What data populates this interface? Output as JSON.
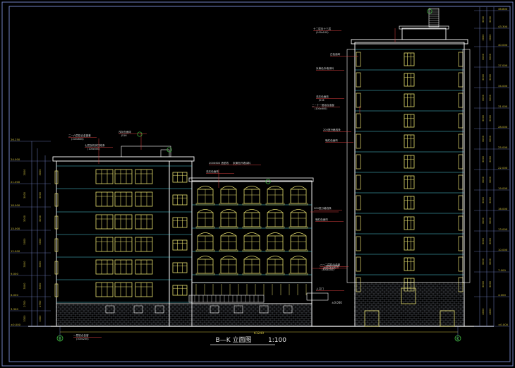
{
  "drawing": {
    "title": "B—K 立面图",
    "scale": "1:100",
    "grid_start": "B",
    "grid_end": "K",
    "total_dim": "61240",
    "note_ground": "±0.000"
  },
  "left_levels": [
    "26.250",
    "24.000",
    "21.000",
    "18.000",
    "15.000",
    "12.000",
    "9.000",
    "6.000",
    "3.300",
    "±0.000"
  ],
  "right_levels": [
    "46.800",
    "43.300",
    "40.000",
    "37.000",
    "34.000",
    "31.000",
    "28.000",
    "25.000",
    "22.000",
    "19.000",
    "16.000",
    "13.000",
    "10.000",
    "7.000",
    "4.000",
    "±0.000"
  ],
  "left_dims": [
    "3000",
    "3000",
    "3000",
    "3000",
    "3000",
    "3000",
    "2700",
    "3300"
  ],
  "right_dims": [
    "3000",
    "3000",
    "3000",
    "3000",
    "3000",
    "3000",
    "3000",
    "3000",
    "3000",
    "3000",
    "3000",
    "3000",
    "3000",
    "3000",
    "4000"
  ],
  "annotations": [
    {
      "id": "a1",
      "text": "二~六层铝合金窗套",
      "sub": "(100x600)"
    },
    {
      "id": "a2",
      "text": "七层及机房顶线条",
      "sub": "(100x500)"
    },
    {
      "id": "a3",
      "text": "浅灰色面砖",
      "sub": "J516"
    },
    {
      "id": "a4",
      "text": "200X600 造型线",
      "sub": ""
    },
    {
      "id": "a5",
      "text": "浅灰色面砖",
      "sub": ""
    },
    {
      "id": "a6",
      "text": "米黄色外墙涂料",
      "sub": ""
    },
    {
      "id": "a7",
      "text": "200宽分格线条",
      "sub": ""
    },
    {
      "id": "a8",
      "text": "暗红色面砖",
      "sub": ""
    },
    {
      "id": "a9",
      "text": "一~二层铝合金窗",
      "sub": "(300x200)"
    },
    {
      "id": "a10",
      "text": "一层铝合金窗",
      "sub": "(300x200)"
    },
    {
      "id": "a11",
      "text": "十二层至十三层",
      "sub": "(100x100)"
    },
    {
      "id": "a12",
      "text": "浅灰色面砖",
      "sub": "J516"
    },
    {
      "id": "a13",
      "text": "二~十一层铝合金窗",
      "sub": "(100x600)"
    },
    {
      "id": "a14",
      "text": "200宽分格线条",
      "sub": ""
    },
    {
      "id": "a15",
      "text": "暗红色面砖",
      "sub": ""
    },
    {
      "id": "a16",
      "text": "一~二层铝合金窗",
      "sub": "(300x200)"
    },
    {
      "id": "a17",
      "text": "白色面砖",
      "sub": ""
    },
    {
      "id": "a18",
      "text": "米黄色外墙涂料",
      "sub": ""
    },
    {
      "id": "a19",
      "text": "入口门",
      "sub": ""
    }
  ],
  "colors": {
    "background": "#000000",
    "frame": "#6f7fc0",
    "outline": "#ffffff",
    "floor_line": "#4fd0e0",
    "window": "#e8e070",
    "annotation": "#d8d8d8",
    "leader": "#e04040",
    "dimension": "#d0c040",
    "circle": "#40c040",
    "brick": "#9aa3b0"
  }
}
